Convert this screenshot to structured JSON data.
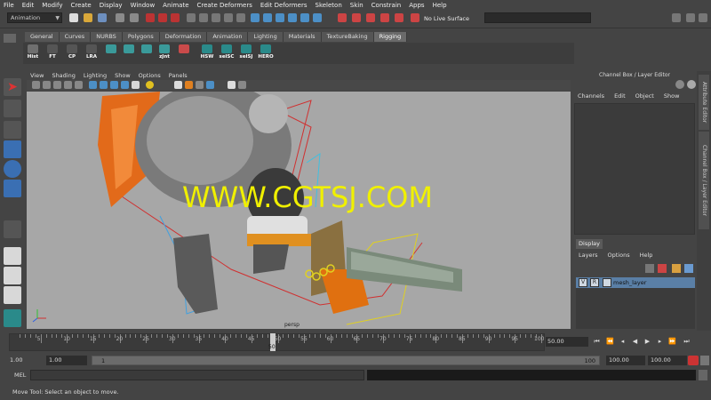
{
  "menubar": [
    "File",
    "Edit",
    "Modify",
    "Create",
    "Display",
    "Window",
    "Animate",
    "Create Deformers",
    "Edit Deformers",
    "Skeleton",
    "Skin",
    "Constrain",
    "Apps",
    "Help"
  ],
  "status_line": {
    "mode": "Animation",
    "live_surface": "No Live Surface"
  },
  "shelf_tabs": [
    {
      "label": "General",
      "active": false
    },
    {
      "label": "Curves",
      "active": false
    },
    {
      "label": "NURBS",
      "active": false
    },
    {
      "label": "Polygons",
      "active": false
    },
    {
      "label": "Deformation",
      "active": false
    },
    {
      "label": "Animation",
      "active": false
    },
    {
      "label": "Lighting",
      "active": false
    },
    {
      "label": "Materials",
      "active": false
    },
    {
      "label": "TextureBaking",
      "active": false
    },
    {
      "label": "Rigging",
      "active": true
    }
  ],
  "shelf_buttons": [
    "Hist",
    "FT",
    "CP",
    "LRA",
    "",
    "",
    "",
    "zJnt",
    "",
    "HSW",
    "selSC",
    "selSJ",
    "HERO"
  ],
  "panel_menu": [
    "View",
    "Shading",
    "Lighting",
    "Show",
    "Options",
    "Panels"
  ],
  "viewport": {
    "camera": "persp",
    "watermark": "WWW.CGTSJ.COM"
  },
  "channel_box": {
    "title": "Channel Box / Layer Editor",
    "menu": [
      "Channels",
      "Edit",
      "Object",
      "Show"
    ]
  },
  "side_tabs": [
    "Attribute Editor",
    "Channel Box / Layer Editor"
  ],
  "layer_editor": {
    "tab": "Display",
    "menu": [
      "Layers",
      "Options",
      "Help"
    ],
    "layer": {
      "visible": "V",
      "ref": "R",
      "name": "mesh_layer"
    }
  },
  "timeline": {
    "ticks": [
      "5",
      "10",
      "15",
      "20",
      "25",
      "30",
      "35",
      "40",
      "45",
      "50",
      "55",
      "60",
      "65",
      "70",
      "75",
      "80",
      "85",
      "90",
      "95",
      "100"
    ],
    "current_frame": "50",
    "end_field": "50.00"
  },
  "range": {
    "start": "1.00",
    "playback_start": "1.00",
    "slider_start": "1",
    "slider_end": "100",
    "playback_end": "100.00",
    "end": "100.00"
  },
  "command_line": {
    "label": "MEL"
  },
  "help_line": "Move Tool: Select an object to move.",
  "colors": {
    "ui_bg": "#444444",
    "viewport_bg": "#a7a7a7",
    "watermark": "#f0f000",
    "layer_highlight": "#5a7fa6"
  }
}
